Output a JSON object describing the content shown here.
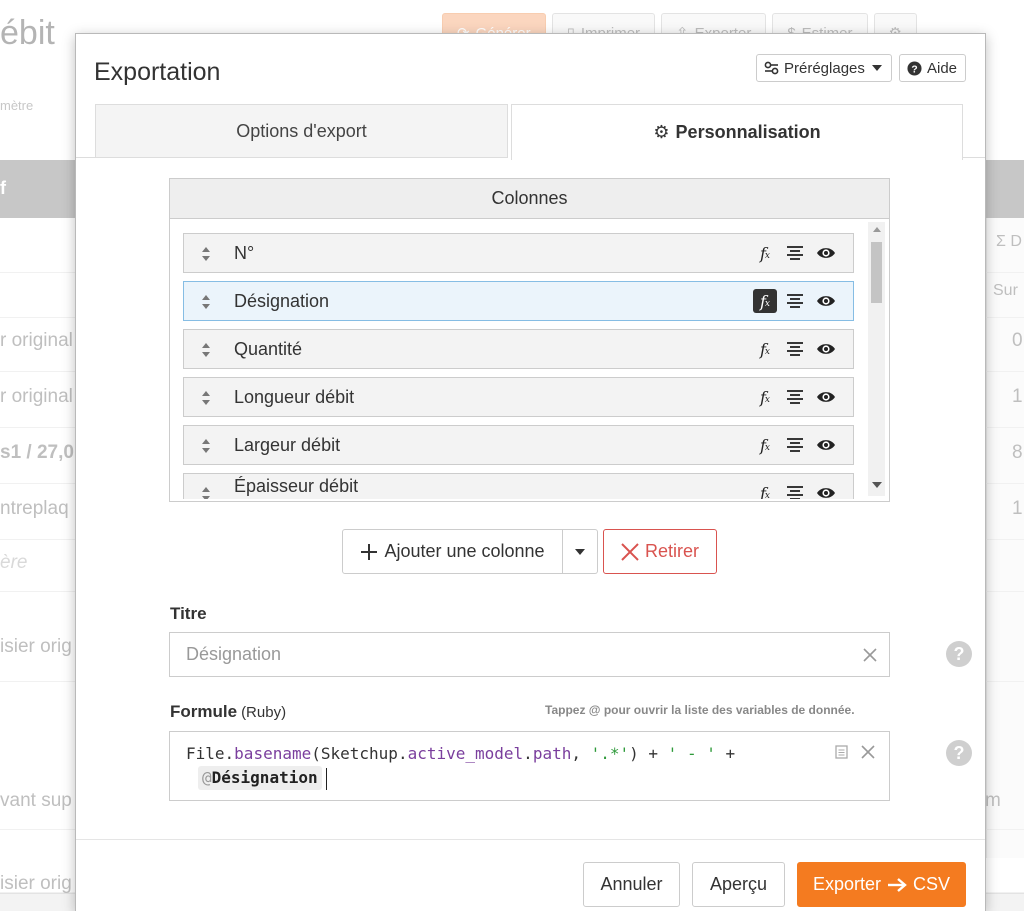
{
  "background": {
    "page_title": "ébit",
    "toolbar": [
      "Générer",
      "Imprimer",
      "Exporter",
      "Estimer"
    ],
    "subtitle": "mètre",
    "header_label": "f",
    "rows": [
      {
        "label": "r original",
        "value": "0"
      },
      {
        "label": "r original",
        "value": "1"
      },
      {
        "label": "s1 / 27,0",
        "value": "8"
      },
      {
        "label": "ntreplaq",
        "value": "1"
      },
      {
        "label": "ère",
        "value": ""
      },
      {
        "label": "isier orig",
        "value": ""
      },
      {
        "label": "vant sup",
        "value": "m"
      },
      {
        "label": "isier orig",
        "value": ""
      }
    ],
    "right_headers": [
      "Σ D",
      "Sur"
    ]
  },
  "modal": {
    "title": "Exportation",
    "presets_label": "Préréglages",
    "help_label": "Aide",
    "tabs": {
      "options": "Options d'export",
      "custom": "Personnalisation"
    },
    "columns_title": "Colonnes",
    "columns": [
      {
        "label": "N°",
        "selected": false
      },
      {
        "label": "Désignation",
        "selected": true
      },
      {
        "label": "Quantité",
        "selected": false
      },
      {
        "label": "Longueur débit",
        "selected": false
      },
      {
        "label": "Largeur débit",
        "selected": false
      },
      {
        "label": "Épaisseur débit",
        "selected": false
      }
    ],
    "add_column_label": "Ajouter une colonne",
    "remove_label": "Retirer",
    "title_field": {
      "label": "Titre",
      "placeholder": "Désignation"
    },
    "formula": {
      "label": "Formule",
      "language": "(Ruby)",
      "hint": "Tappez @ pour ouvrir la liste des variables de donnée.",
      "tokens": {
        "cls": "File",
        "m1": "basename",
        "p1": "(Sketchup",
        "m2": "active_model",
        "m3": "path",
        "str1": "'.*'",
        "close": ") + ",
        "str2": "' - '",
        "plus": " +",
        "var_at": "@",
        "var_name": "Désignation"
      }
    },
    "footer": {
      "cancel": "Annuler",
      "preview": "Aperçu",
      "export": "Exporter",
      "export_format": "CSV"
    },
    "colors": {
      "accent": "#f47b20",
      "danger": "#d9534f",
      "selected_row": "#ebf4fb"
    }
  }
}
